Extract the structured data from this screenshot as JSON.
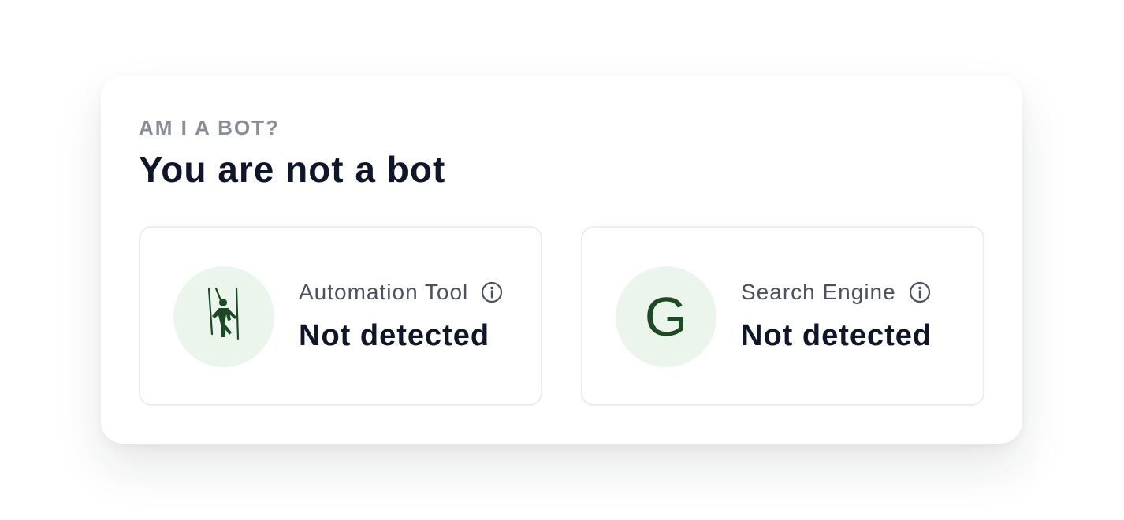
{
  "card": {
    "eyebrow": "AM I A BOT?",
    "title": "You are not a bot"
  },
  "checks": [
    {
      "label": "Automation Tool",
      "status": "Not detected",
      "icon": "puppet-icon",
      "info_icon": "info-icon"
    },
    {
      "label": "Search Engine",
      "status": "Not detected",
      "icon": "google-g-icon",
      "icon_glyph": "G",
      "info_icon": "info-icon"
    }
  ],
  "colors": {
    "icon_bg": "#ebf5ec",
    "icon_fg": "#1d4a24",
    "heading": "#0f1629",
    "muted": "#8a8d98"
  }
}
